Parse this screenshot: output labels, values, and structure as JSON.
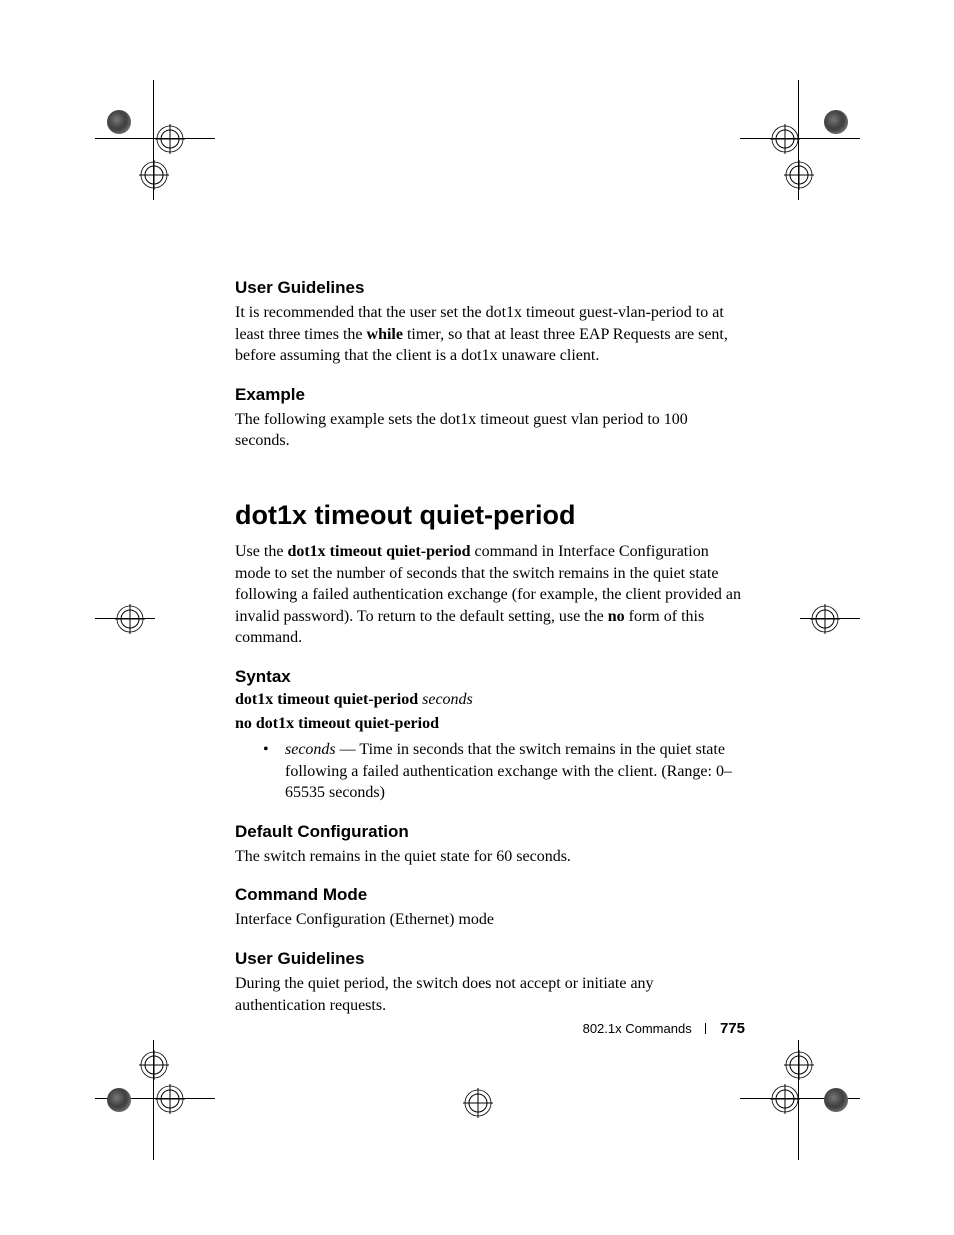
{
  "sections": {
    "user_guidelines_1": {
      "heading": "User Guidelines",
      "body_prefix": "It is recommended that the user set the dot1x timeout guest-vlan-period to at least three times the ",
      "bold_word": "while",
      "body_suffix": " timer, so that at least three EAP Requests are sent, before assuming that the client is a dot1x unaware client."
    },
    "example": {
      "heading": "Example",
      "body": "The following example sets the dot1x timeout guest vlan period to 100 seconds."
    },
    "main_title": "dot1x timeout quiet-period",
    "intro": {
      "prefix": "Use the ",
      "bold1": "dot1x timeout quiet-period",
      "mid": " command in Interface Configuration mode to set the number of seconds that the switch remains in the quiet state following a failed authentication exchange (for example, the client provided an invalid password). To return to the default setting, use the ",
      "bold2": "no",
      "suffix": " form of this command."
    },
    "syntax": {
      "heading": "Syntax",
      "line1_bold": "dot1x timeout quiet-period",
      "line1_italic": "seconds",
      "line2_bold": "no dot1x timeout quiet-period",
      "bullet_term": "seconds",
      "bullet_text": " — Time in seconds that the switch remains in the quiet state following a failed authentication exchange with the client. (Range: 0–65535 seconds)"
    },
    "default_config": {
      "heading": "Default Configuration",
      "body": "The switch remains in the quiet state for 60 seconds."
    },
    "command_mode": {
      "heading": "Command Mode",
      "body": "Interface Configuration (Ethernet) mode"
    },
    "user_guidelines_2": {
      "heading": "User Guidelines",
      "body": "During the quiet period, the switch does not accept or initiate any authentication requests."
    }
  },
  "footer": {
    "section_label": "802.1x Commands",
    "page_number": "775"
  }
}
